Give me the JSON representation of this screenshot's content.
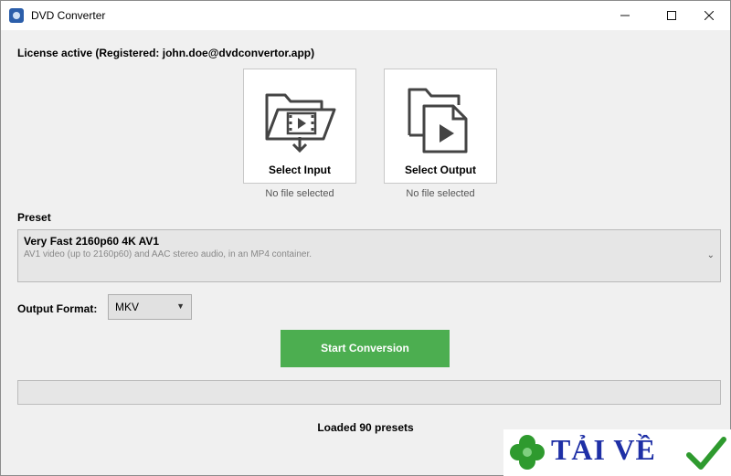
{
  "window": {
    "title": "DVD Converter",
    "controls": {
      "minimize": "minimize",
      "maximize": "maximize",
      "close": "close"
    }
  },
  "license": {
    "text": "License active (Registered: john.doe@dvdconvertor.app)"
  },
  "input": {
    "label": "Select Input",
    "status": "No file selected",
    "icon": "folder-video-import-icon"
  },
  "output": {
    "label": "Select Output",
    "status": "No file selected",
    "icon": "file-video-play-icon"
  },
  "preset": {
    "label": "Preset",
    "selected_name": "Very Fast 2160p60 4K AV1",
    "selected_description": "AV1 video (up to 2160p60) and AAC stereo audio, in an MP4  container."
  },
  "format": {
    "label": "Output Format:",
    "selected": "MKV"
  },
  "actions": {
    "start_label": "Start Conversion"
  },
  "progress": {
    "value": 0
  },
  "status": {
    "text": "Loaded 90 presets"
  },
  "watermark": {
    "text": "TẢI VỀ"
  },
  "colors": {
    "accent_green": "#4cae50",
    "watermark_blue": "#1e2fa6"
  }
}
